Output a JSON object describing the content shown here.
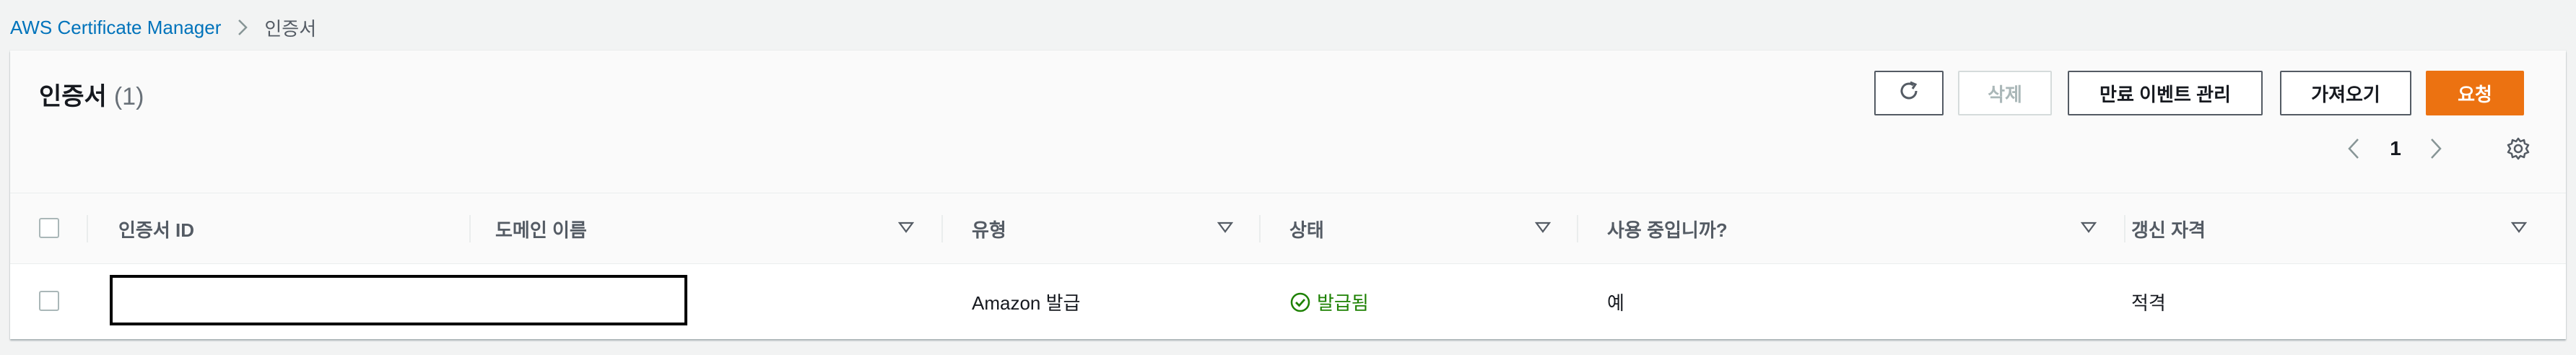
{
  "breadcrumb": {
    "root": "AWS Certificate Manager",
    "current": "인증서"
  },
  "panel": {
    "title": "인증서",
    "count": "(1)"
  },
  "toolbar": {
    "refresh_icon": "refresh-icon",
    "delete_label": "삭제",
    "manage_events_label": "만료 이벤트 관리",
    "import_label": "가져오기",
    "request_label": "요청"
  },
  "pagination": {
    "current_page": "1"
  },
  "table": {
    "columns": [
      "인증서 ID",
      "도메인 이름",
      "유형",
      "상태",
      "사용 중입니까?",
      "갱신 자격"
    ],
    "rows": [
      {
        "certificate_id": "",
        "domain_name": "",
        "type": "Amazon 발급",
        "status": "발급됨",
        "in_use": "예",
        "renewal_eligibility": "적격"
      }
    ]
  },
  "colors": {
    "primary": "#ec7211",
    "link": "#0073bb",
    "success": "#1d8102"
  }
}
